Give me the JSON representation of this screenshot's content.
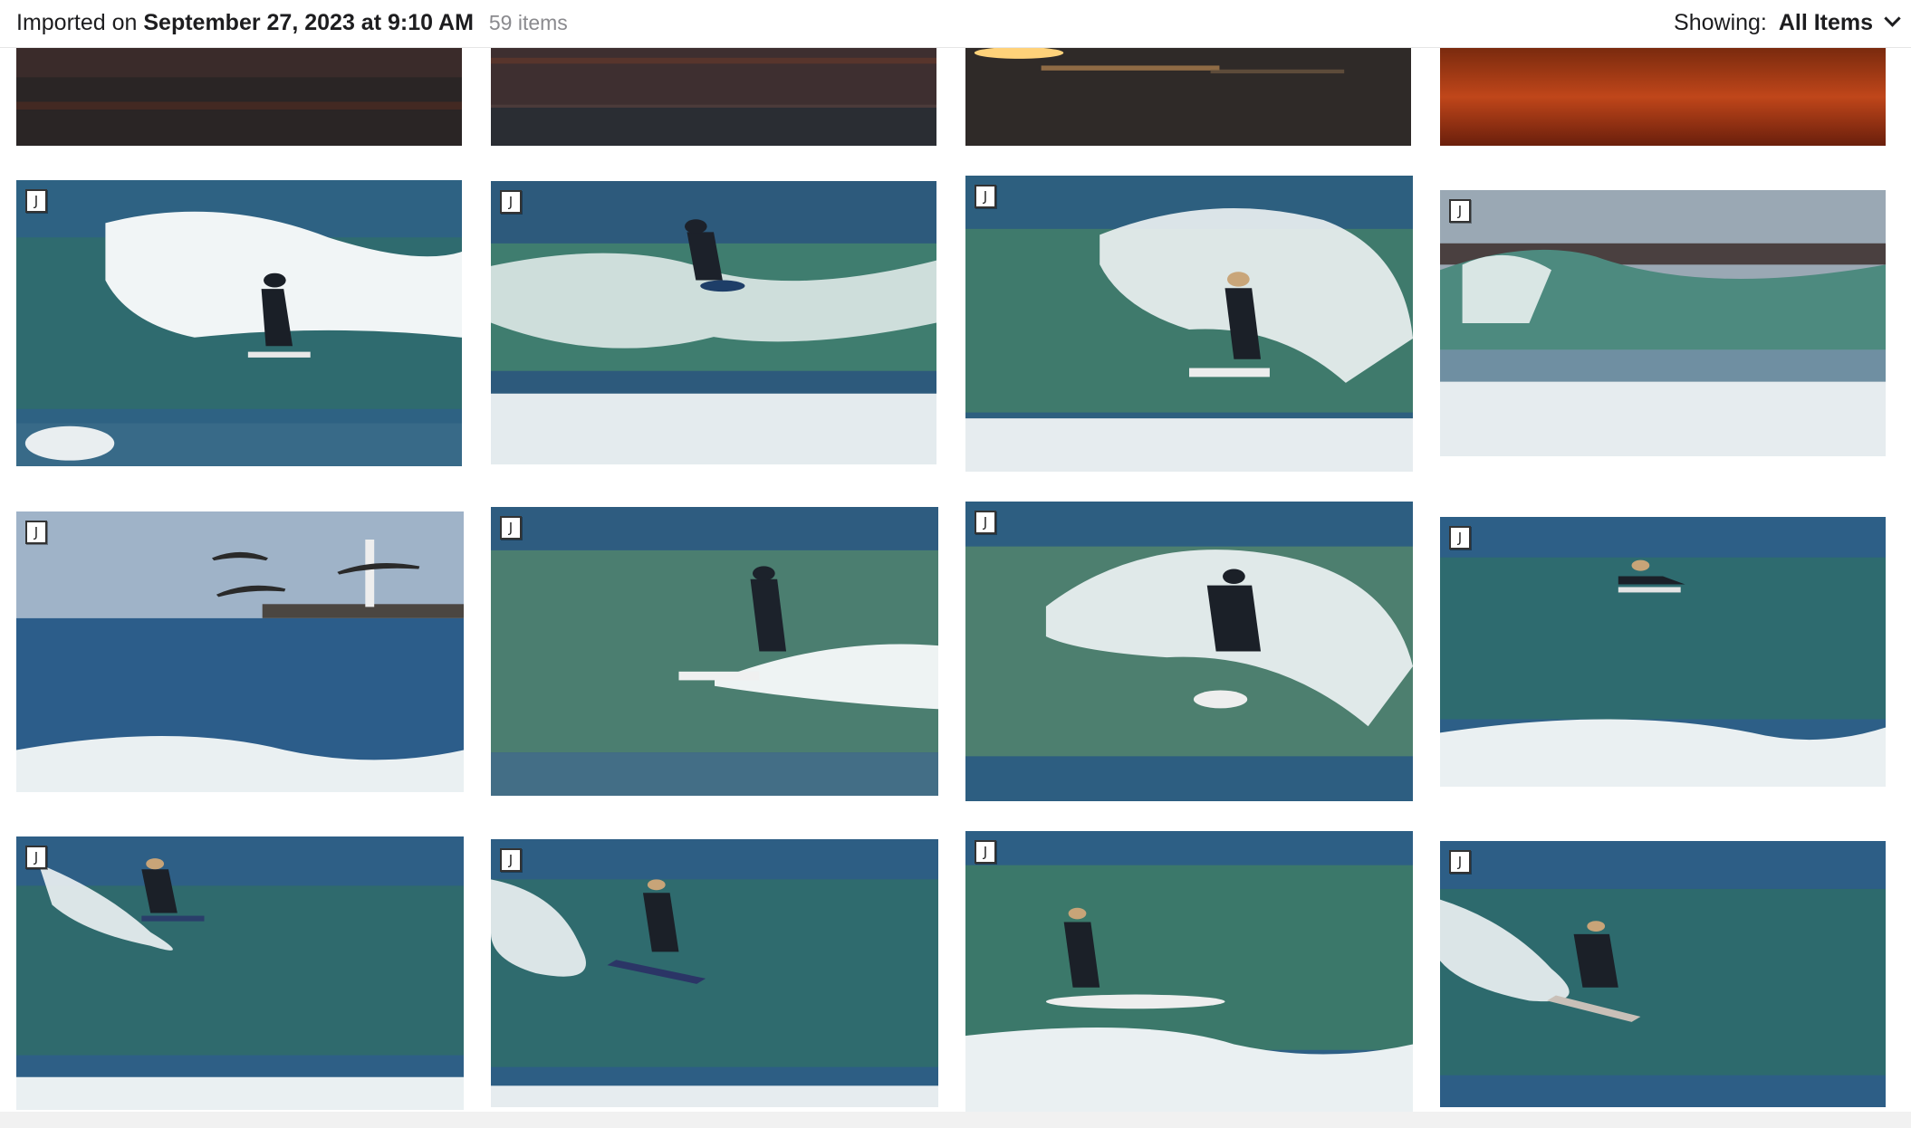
{
  "header": {
    "imported_prefix": "Imported on",
    "imported_date": "September 27, 2023 at 9:10 AM",
    "item_count": "59 items",
    "showing_label": "Showing:",
    "showing_value": "All Items"
  },
  "badge_label": "J",
  "colors": {
    "sunset_dark": "#2b2a2e",
    "sunset_orange": "#b8431a",
    "ocean_blue": "#2e5f86",
    "wave_green": "#3f7a6c",
    "foam": "#eef3f5"
  }
}
